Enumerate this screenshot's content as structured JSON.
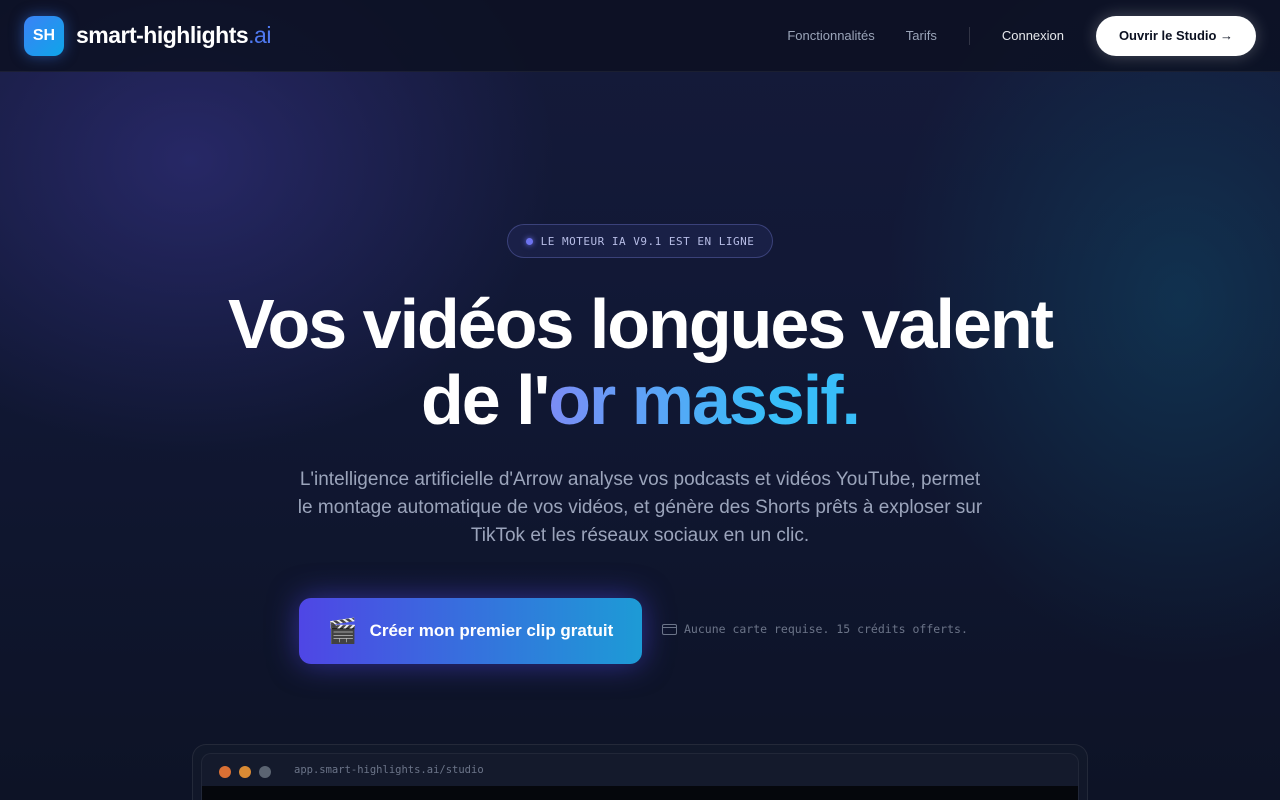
{
  "header": {
    "logo_badge": "SH",
    "logo_name": "smart-highlights",
    "logo_suffix": ".ai",
    "nav": [
      "Fonctionnalités",
      "Tarifs"
    ],
    "login": "Connexion",
    "cta": "Ouvrir le Studio →"
  },
  "hero": {
    "badge": "LE MOTEUR IA V9.1 EST EN LIGNE",
    "title_line1": "Vos vidéos longues valent",
    "title_line2_prefix": "de l'",
    "title_line2_highlight": "or massif.",
    "subtitle": "L'intelligence artificielle d'Arrow analyse vos podcasts et vidéos YouTube, permet le montage automatique de vos vidéos, et génère des Shorts prêts à exploser sur TikTok et les réseaux sociaux en un clic.",
    "cta": "Créer mon premier clip gratuit",
    "cta_icon": "🎬",
    "note": "Aucune carte requise. 15 crédits offerts."
  },
  "preview": {
    "url": "app.smart-highlights.ai/studio"
  },
  "colors": {
    "accent": "#4f46e5",
    "accent2": "#38bdf8",
    "background": "#111835"
  }
}
